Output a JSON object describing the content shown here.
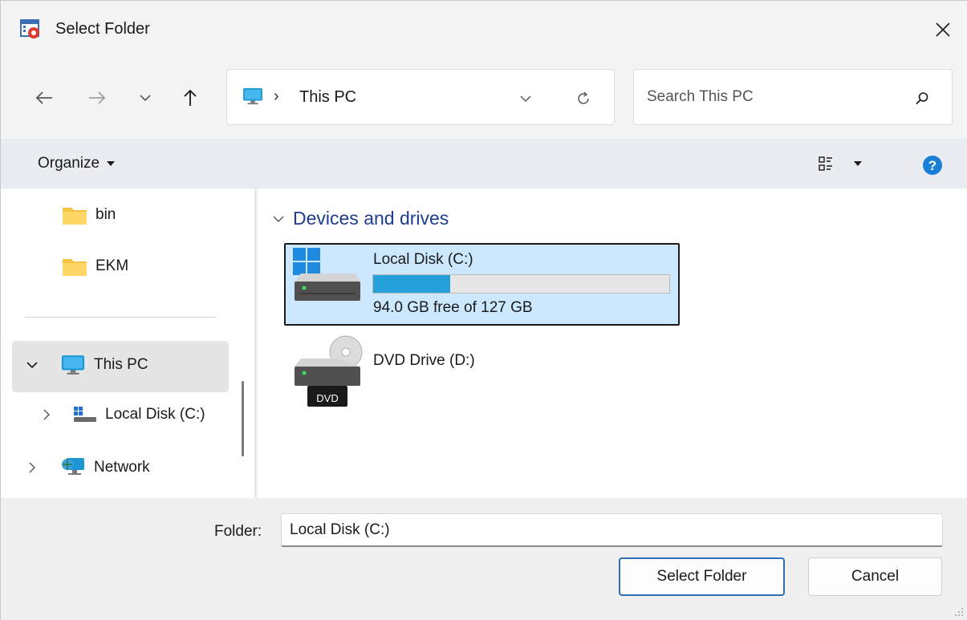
{
  "window": {
    "title": "Select Folder"
  },
  "nav": {
    "back_icon": "arrow-left-icon",
    "forward_icon": "arrow-right-icon",
    "recent_icon": "chevron-down-icon",
    "up_icon": "arrow-up-icon"
  },
  "address": {
    "location": "This PC"
  },
  "search": {
    "placeholder": "Search This PC"
  },
  "toolbar": {
    "organize_label": "Organize"
  },
  "navpane": {
    "items": [
      {
        "label": "bin",
        "icon": "folder-icon"
      },
      {
        "label": "EKM",
        "icon": "folder-icon"
      },
      {
        "label": "This PC",
        "icon": "computer-icon"
      },
      {
        "label": "Local Disk (C:)",
        "icon": "drive-icon"
      },
      {
        "label": "Network",
        "icon": "network-icon"
      }
    ]
  },
  "content": {
    "group_title": "Devices and drives",
    "drives": [
      {
        "name": "Local Disk (C:)",
        "free_text": "94.0 GB free of 127 GB",
        "used_fraction": 0.26
      },
      {
        "name": "DVD Drive (D:)",
        "badge": "DVD"
      }
    ]
  },
  "footer": {
    "folder_label": "Folder:",
    "folder_value": "Local Disk (C:)",
    "select_button": "Select Folder",
    "cancel_button": "Cancel"
  },
  "colors": {
    "accent": "#26a0da",
    "selection": "#cce8ff",
    "group_header": "#1e3d8f"
  }
}
